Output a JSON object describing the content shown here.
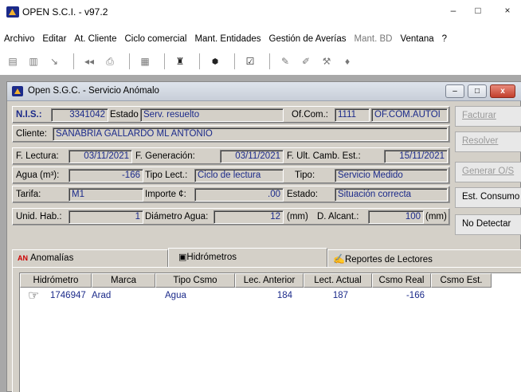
{
  "app": {
    "title": "OPEN S.C.I.  -  v97.2",
    "window_buttons": {
      "minimize": "–",
      "maximize": "□",
      "close": "×"
    }
  },
  "menu": [
    {
      "label": "Archivo",
      "enabled": true
    },
    {
      "label": "Editar",
      "enabled": true
    },
    {
      "label": "At. Cliente",
      "enabled": true
    },
    {
      "label": "Ciclo comercial",
      "enabled": true
    },
    {
      "label": "Mant. Entidades",
      "enabled": true
    },
    {
      "label": "Gestión de Averías",
      "enabled": true
    },
    {
      "label": "Mant. BD",
      "enabled": false
    },
    {
      "label": "Ventana",
      "enabled": true
    },
    {
      "label": "?",
      "enabled": true
    }
  ],
  "toolbar": {
    "icons": [
      "new-icon",
      "print-preview-icon",
      "arrow-icon",
      "back-icon",
      "printer-icon",
      "document-icon",
      "user-icon",
      "ots-icon",
      "checkbox-icon",
      "paint-icon",
      "edit-icon",
      "tool-icon",
      "drop-icon"
    ]
  },
  "child": {
    "title": "Open S.G.C. - Servicio Anómalo",
    "buttons": {
      "minimize": "–",
      "maximize": "□",
      "close": "x"
    }
  },
  "form": {
    "nis_label": "N.I.S.:",
    "nis_value": "3341042",
    "estado_label": "Estado",
    "estado_value": "Serv. resuelto",
    "ofcom_label": "Of.Com.:",
    "ofcom_code": "1111",
    "ofcom_name": "OF.COM.AUTOI",
    "cliente_label": "Cliente:",
    "cliente_value": "SANABRIA GALLARDO ML ANTONIO",
    "flectura_label": "F. Lectura:",
    "flectura_value": "03/11/2021",
    "fgen_label": "F. Generación:",
    "fgen_value": "03/11/2021",
    "fult_label": "F. Ult. Camb. Est.:",
    "fult_value": "15/11/2021",
    "agua_label": "Agua (m³):",
    "agua_value": "-166",
    "tipolect_label": "Tipo Lect.:",
    "tipolect_value": "Ciclo de lectura",
    "tipo_label": "Tipo:",
    "tipo_value": "Servicio Medido",
    "tarifa_label": "Tarifa:",
    "tarifa_value": "M1",
    "importe_label": "Importe ¢:",
    "importe_value": ".00",
    "estado2_label": "Estado:",
    "estado2_value": "Situación correcta",
    "unidhab_label": "Unid. Hab.:",
    "unidhab_value": "1",
    "diam_label": "Diámetro Agua:",
    "diam_value": "12",
    "diam_unit": "(mm)",
    "dalc_label": "D. Alcant.:",
    "dalc_value": "100",
    "dalc_unit": "(mm)"
  },
  "side_buttons": [
    {
      "label": "Facturar",
      "enabled": false
    },
    {
      "label": "Resolver",
      "enabled": false
    },
    {
      "label": "Generar O/S",
      "enabled": false
    },
    {
      "label": "Est. Consumo",
      "enabled": true
    },
    {
      "label": "No Detectar",
      "enabled": true
    }
  ],
  "tabs": [
    {
      "label": "Anomalías",
      "icon": "AN"
    },
    {
      "label": "Hidrómetros",
      "icon": "meter-icon"
    },
    {
      "label": "Reportes de Lectores",
      "icon": "readers-icon"
    }
  ],
  "grid": {
    "headers": [
      "Hidrómetro",
      "Marca",
      "Tipo Csmo",
      "Lec. Anterior",
      "Lect. Actual",
      "Csmo Real",
      "Csmo Est."
    ],
    "rows": [
      {
        "hidrometro": "1746947",
        "marca": "Arad",
        "tipo": "Agua",
        "anterior": "184",
        "actual": "187",
        "real": "-166",
        "est": ""
      }
    ]
  }
}
